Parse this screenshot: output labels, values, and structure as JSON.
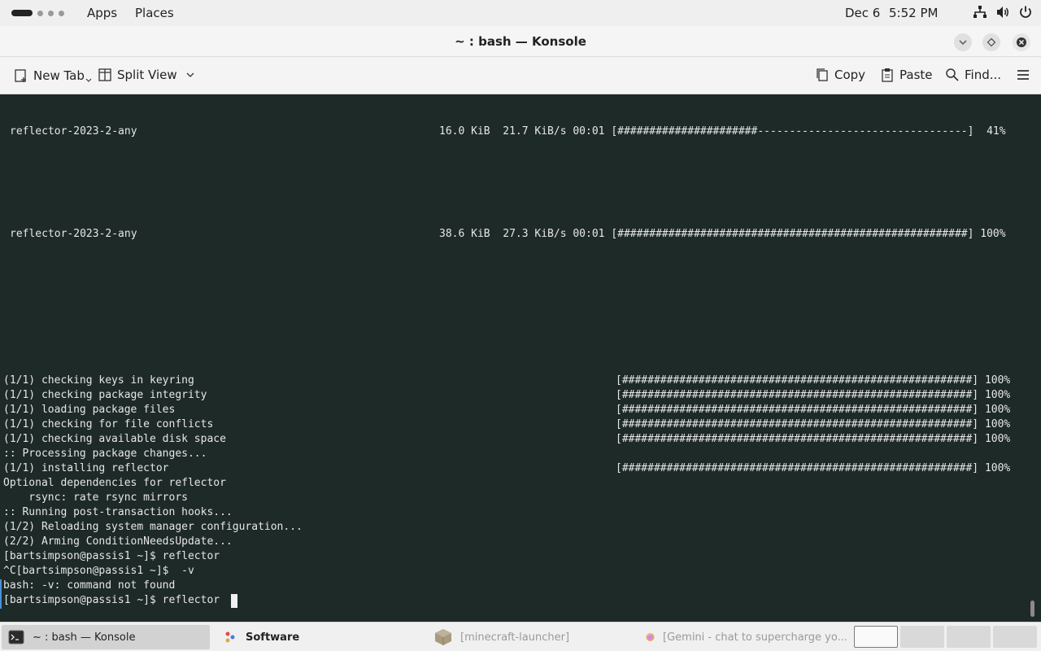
{
  "top_panel": {
    "apps_label": "Apps",
    "places_label": "Places",
    "date": "Dec 6",
    "time": "5:52 PM",
    "tray_icons": [
      "network-icon",
      "volume-icon",
      "power-icon"
    ]
  },
  "window": {
    "title": "~ : bash — Konsole",
    "buttons": [
      "minimize-icon",
      "maximize-icon",
      "close-icon"
    ]
  },
  "toolbar": {
    "new_tab": "New Tab",
    "split_view": "Split View",
    "copy": "Copy",
    "paste": "Paste",
    "find": "Find...",
    "menu_icon": "hamburger-menu-icon"
  },
  "terminal": {
    "download1": {
      "name": "reflector-2023-2-any",
      "stats": "16.0 KiB  21.7 KiB/s 00:01 [######################---------------------------------]  41%",
      "progress": 0.41
    },
    "download2": {
      "name": "reflector-2023-2-any",
      "stats": "38.6 KiB  27.3 KiB/s 00:01 [#######################################################] 100%",
      "progress": 1.0
    },
    "steps": [
      {
        "text": "(1/1) checking keys in keyring",
        "bar": "[#######################################################] 100%"
      },
      {
        "text": "(1/1) checking package integrity",
        "bar": "[#######################################################] 100%"
      },
      {
        "text": "(1/1) loading package files",
        "bar": "[#######################################################] 100%"
      },
      {
        "text": "(1/1) checking for file conflicts",
        "bar": "[#######################################################] 100%"
      },
      {
        "text": "(1/1) checking available disk space",
        "bar": "[#######################################################] 100%"
      },
      {
        "text": ":: Processing package changes...",
        "bar": ""
      },
      {
        "text": "(1/1) installing reflector",
        "bar": "[#######################################################] 100%"
      },
      {
        "text": "Optional dependencies for reflector",
        "bar": ""
      },
      {
        "text": "    rsync: rate rsync mirrors",
        "bar": ""
      },
      {
        "text": ":: Running post-transaction hooks...",
        "bar": ""
      },
      {
        "text": "(1/2) Reloading system manager configuration...",
        "bar": ""
      },
      {
        "text": "(2/2) Arming ConditionNeedsUpdate...",
        "bar": ""
      },
      {
        "text": "[bartsimpson@passis1 ~]$ reflector",
        "bar": ""
      },
      {
        "text": "^C[bartsimpson@passis1 ~]$  -v",
        "bar": ""
      },
      {
        "text": "bash: -v: command not found",
        "bar": ""
      },
      {
        "text": "[bartsimpson@passis1 ~]$ reflector ",
        "bar": ""
      }
    ]
  },
  "taskbar": {
    "tasks": [
      {
        "label": "~ : bash — Konsole",
        "icon": "terminal-icon"
      },
      {
        "label": "Software",
        "icon": "software-icon"
      },
      {
        "label": "[minecraft-launcher]",
        "icon": "minecraft-icon"
      },
      {
        "label": "[Gemini - chat to supercharge yo...",
        "icon": "firefox-icon"
      }
    ],
    "workspaces": 4
  },
  "colors": {
    "terminal_bg": "#1e2a27",
    "terminal_fg": "#e6e6e6",
    "panel_bg": "#efefef"
  }
}
